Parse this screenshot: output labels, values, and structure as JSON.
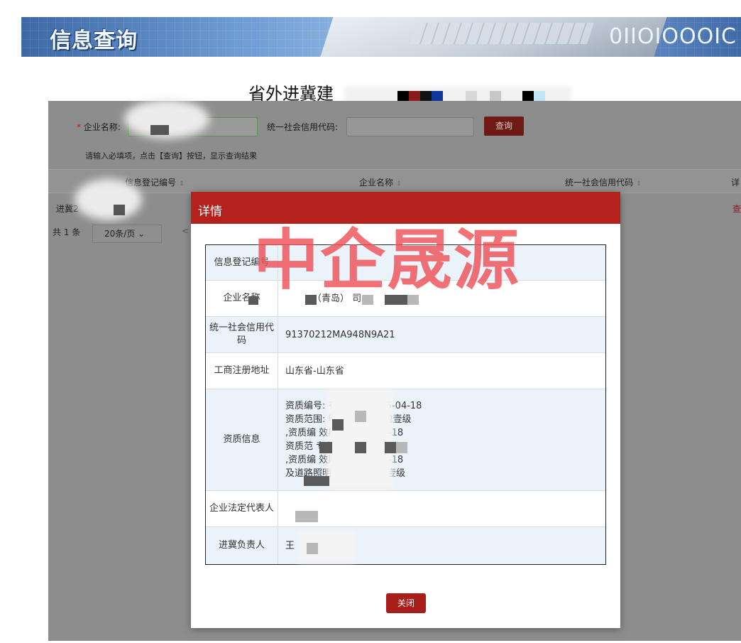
{
  "banner": {
    "title": "信息查询",
    "binary_text": "0110001",
    "binary_text_display": "0IIOIOOOIC"
  },
  "page": {
    "title": "省外进冀建"
  },
  "search": {
    "company_label": "企业名称:",
    "required_mark": "*",
    "code_label": "统一社会信用代码:",
    "query_button": "查询",
    "hint": "请输入必填项，点击【查询】按钮，显示查询结果"
  },
  "table": {
    "columns": [
      "信息登记编号",
      "企业名称",
      "统一社会信用代码",
      "详"
    ],
    "sort_icon": "⇕",
    "row": {
      "reg_no_partial": "进冀2",
      "action_partial": "查"
    }
  },
  "pager": {
    "total": "共 1 条",
    "page_size": "20条/页",
    "prev": "<"
  },
  "modal": {
    "title": "详情",
    "watermark": "中企晟源",
    "fields": [
      {
        "label": "信息登记编号",
        "value": ""
      },
      {
        "label": "企业名称",
        "value": "（青岛）   司"
      },
      {
        "label": "统一社会信用代码",
        "value": "91370212MA948N9A21"
      },
      {
        "label": "工商注册地址",
        "value": "山东省-山东省"
      },
      {
        "label": "资质信息",
        "lines": [
          "资质编号:          有效期至:2025-04-18",
          "资质范围:          明工程专业承包壹级",
          ",资质编          效期至:2025-04-18",
          "资质范          专业承包壹级",
          ",资质编          效期至:2025-04-18",
          "        及道路照明工程专业承包壹级"
        ]
      },
      {
        "label": "企业法定代表人",
        "value": ""
      },
      {
        "label": "进冀负责人",
        "value": "王"
      }
    ],
    "close_button": "关闭"
  }
}
